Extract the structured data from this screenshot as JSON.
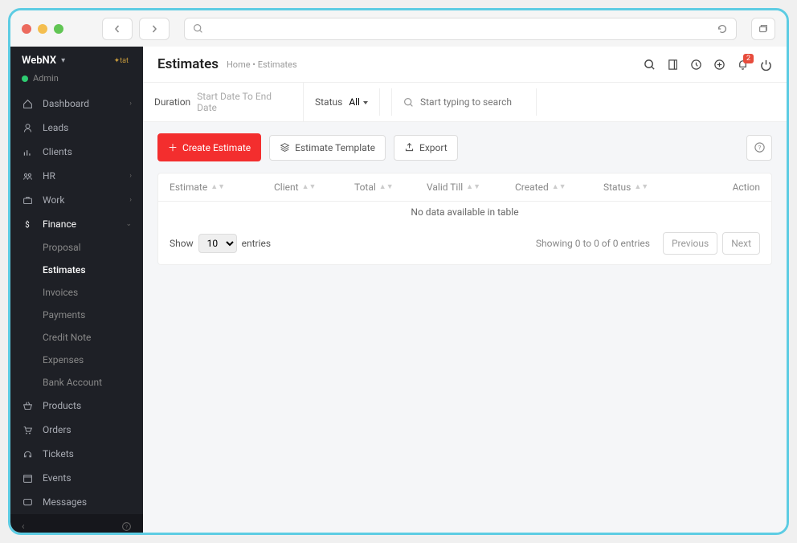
{
  "brand": {
    "name": "WebNX",
    "role": "Admin"
  },
  "sidebar": {
    "items": [
      {
        "label": "Dashboard",
        "expandable": true
      },
      {
        "label": "Leads"
      },
      {
        "label": "Clients"
      },
      {
        "label": "HR",
        "expandable": true
      },
      {
        "label": "Work",
        "expandable": true
      },
      {
        "label": "Finance",
        "expandable": true,
        "active": true
      },
      {
        "label": "Products"
      },
      {
        "label": "Orders"
      },
      {
        "label": "Tickets"
      },
      {
        "label": "Events"
      },
      {
        "label": "Messages"
      }
    ],
    "finance_sub": [
      {
        "label": "Proposal"
      },
      {
        "label": "Estimates",
        "active": true
      },
      {
        "label": "Invoices"
      },
      {
        "label": "Payments"
      },
      {
        "label": "Credit Note"
      },
      {
        "label": "Expenses"
      },
      {
        "label": "Bank Account"
      }
    ]
  },
  "header": {
    "title": "Estimates",
    "crumbs": "Home • Estimates",
    "notif_badge": "2"
  },
  "filters": {
    "duration_label": "Duration",
    "duration_placeholder": "Start Date To End Date",
    "status_label": "Status",
    "status_value": "All",
    "search_placeholder": "Start typing to search"
  },
  "actions": {
    "create": "Create Estimate",
    "template": "Estimate Template",
    "export": "Export"
  },
  "table": {
    "cols": {
      "estimate": "Estimate",
      "client": "Client",
      "total": "Total",
      "valid": "Valid Till",
      "created": "Created",
      "status": "Status",
      "action": "Action"
    },
    "empty": "No data available in table",
    "show": "Show",
    "page_size": "10",
    "entries": "entries",
    "info": "Showing 0 to 0 of 0 entries",
    "prev": "Previous",
    "next": "Next"
  }
}
